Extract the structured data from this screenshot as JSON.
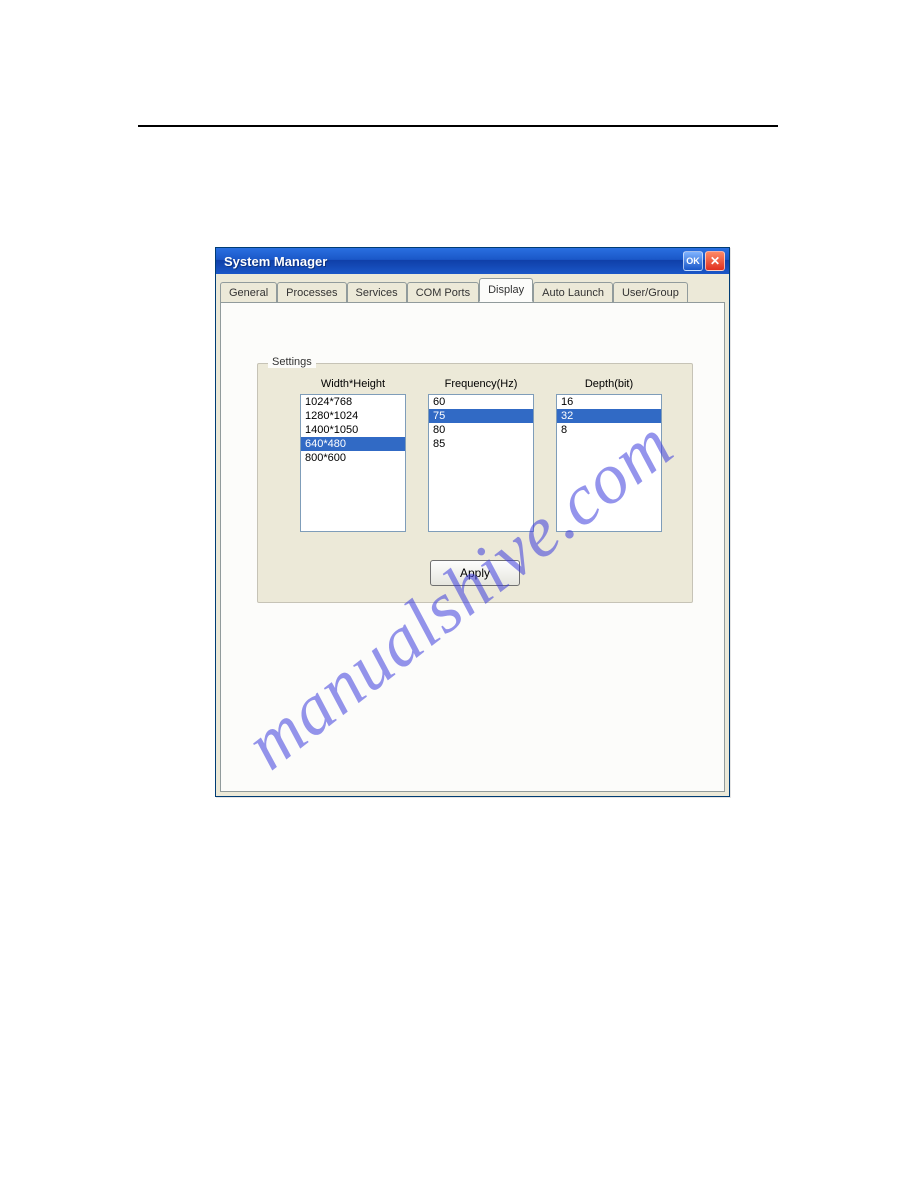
{
  "watermark": "manualshive.com",
  "window": {
    "title": "System Manager",
    "ok_label": "OK",
    "close_label": "✕"
  },
  "tabs": [
    {
      "label": "General",
      "active": false
    },
    {
      "label": "Processes",
      "active": false
    },
    {
      "label": "Services",
      "active": false
    },
    {
      "label": "COM Ports",
      "active": false
    },
    {
      "label": "Display",
      "active": true
    },
    {
      "label": "Auto Launch",
      "active": false
    },
    {
      "label": "User/Group",
      "active": false
    }
  ],
  "settings": {
    "group_label": "Settings",
    "columns": {
      "resolution": {
        "label": "Width*Height",
        "items": [
          "1024*768",
          "1280*1024",
          "1400*1050",
          "640*480",
          "800*600"
        ],
        "selected_index": 3
      },
      "frequency": {
        "label": "Frequency(Hz)",
        "items": [
          "60",
          "75",
          "80",
          "85"
        ],
        "selected_index": 1
      },
      "depth": {
        "label": "Depth(bit)",
        "items": [
          "16",
          "32",
          "8"
        ],
        "selected_index": 1
      }
    },
    "apply_label": "Apply"
  }
}
